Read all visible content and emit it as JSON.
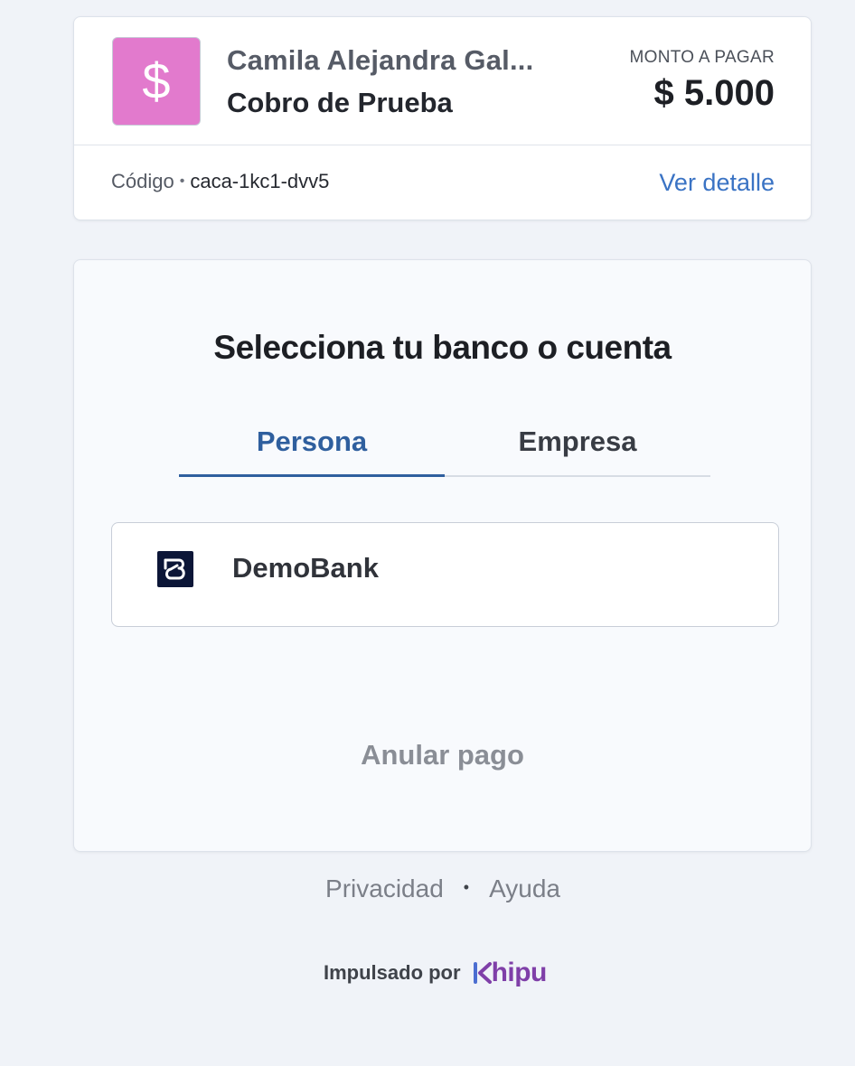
{
  "merchant": {
    "avatar_symbol": "$",
    "avatar_color": "#e27acd",
    "name": "Camila Alejandra Gal...",
    "subject": "Cobro de Prueba"
  },
  "payment": {
    "amount_label": "MONTO A PAGAR",
    "amount": "$ 5.000",
    "code_label": "Código",
    "code_value": "caca-1kc1-dvv5",
    "detail_link": "Ver detalle"
  },
  "bank_selection": {
    "title": "Selecciona tu banco o cuenta",
    "tabs": [
      {
        "label": "Persona",
        "active": true
      },
      {
        "label": "Empresa",
        "active": false
      }
    ],
    "banks": [
      {
        "name": "DemoBank",
        "icon": "demobank-logo-icon"
      }
    ],
    "cancel_label": "Anular pago"
  },
  "footer": {
    "privacy": "Privacidad",
    "separator": "•",
    "help": "Ayuda",
    "powered_by": "Impulsado por",
    "brand": "Khipu"
  },
  "colors": {
    "accent": "#2f5f9e",
    "link": "#3a73c4",
    "brand_purple": "#7f3fa8",
    "brand_blue": "#4b6ed1"
  }
}
